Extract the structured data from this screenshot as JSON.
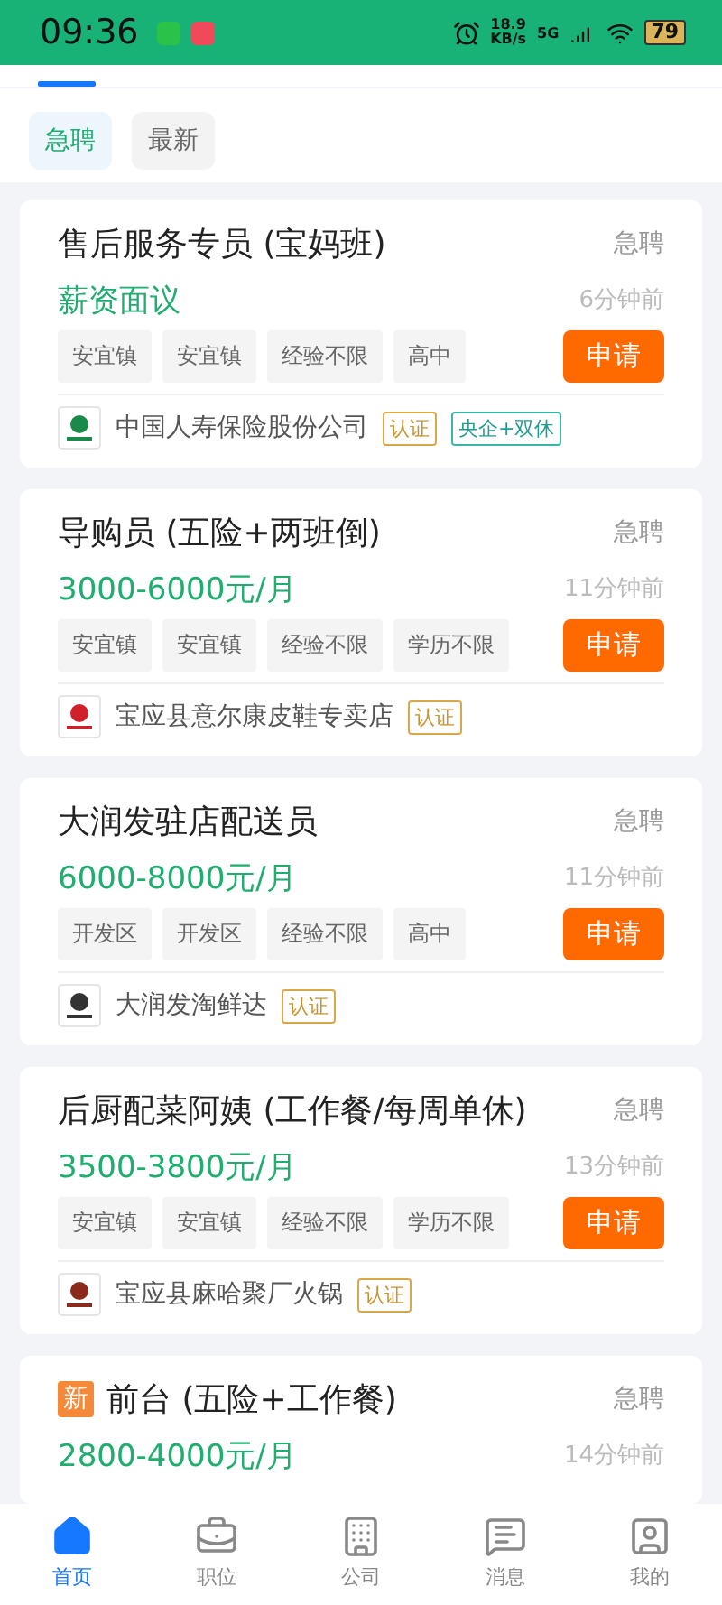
{
  "status_bar": {
    "time": "09:36",
    "speed": "18.9",
    "speed_unit": "KB/s",
    "network": "5G",
    "battery": "79"
  },
  "filters": [
    {
      "label": "急聘",
      "selected": true
    },
    {
      "label": "最新",
      "selected": false
    }
  ],
  "jobs": [
    {
      "is_new": false,
      "title": "售后服务专员 (宝妈班)",
      "urgent": "急聘",
      "salary": "薪资面议",
      "time": "6分钟前",
      "tags": [
        "安宜镇",
        "安宜镇",
        "经验不限",
        "高中"
      ],
      "apply": "申请",
      "company": "中国人寿保险股份公司",
      "badges": [
        {
          "label": "认证",
          "kind": "verified"
        },
        {
          "label": "央企+双休",
          "kind": "perk"
        }
      ]
    },
    {
      "is_new": false,
      "title": "导购员 (五险+两班倒)",
      "urgent": "急聘",
      "salary": "3000-6000元/月",
      "time": "11分钟前",
      "tags": [
        "安宜镇",
        "安宜镇",
        "经验不限",
        "学历不限"
      ],
      "apply": "申请",
      "company": "宝应县意尔康皮鞋专卖店",
      "badges": [
        {
          "label": "认证",
          "kind": "verified"
        }
      ]
    },
    {
      "is_new": false,
      "title": "大润发驻店配送员",
      "urgent": "急聘",
      "salary": "6000-8000元/月",
      "time": "11分钟前",
      "tags": [
        "开发区",
        "开发区",
        "经验不限",
        "高中"
      ],
      "apply": "申请",
      "company": "大润发淘鲜达",
      "badges": [
        {
          "label": "认证",
          "kind": "verified"
        }
      ]
    },
    {
      "is_new": false,
      "title": "后厨配菜阿姨 (工作餐/每周单休)",
      "urgent": "急聘",
      "salary": "3500-3800元/月",
      "time": "13分钟前",
      "tags": [
        "安宜镇",
        "安宜镇",
        "经验不限",
        "学历不限"
      ],
      "apply": "申请",
      "company": "宝应县麻哈聚厂火锅",
      "badges": [
        {
          "label": "认证",
          "kind": "verified"
        }
      ]
    },
    {
      "is_new": true,
      "new_label": "新",
      "title": "前台 (五险+工作餐)",
      "urgent": "急聘",
      "salary": "2800-4000元/月",
      "time": "14分钟前"
    }
  ],
  "tab_bar": [
    {
      "label": "首页",
      "selected": true
    },
    {
      "label": "职位",
      "selected": false
    },
    {
      "label": "公司",
      "selected": false
    },
    {
      "label": "消息",
      "selected": false
    },
    {
      "label": "我的",
      "selected": false
    }
  ]
}
